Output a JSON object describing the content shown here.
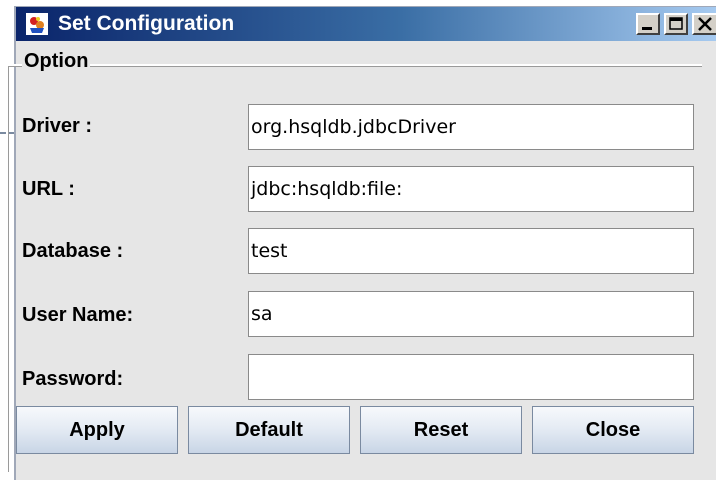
{
  "window": {
    "title": "Set Configuration",
    "icon": "java-cup-icon"
  },
  "title_buttons": {
    "minimize_icon": "minimize-icon",
    "maximize_icon": "maximize-icon",
    "close_icon": "close-icon"
  },
  "option_group": {
    "legend": "Option"
  },
  "fields": {
    "driver": {
      "label": "Driver :",
      "value": "org.hsqldb.jdbcDriver"
    },
    "url": {
      "label": "URL :",
      "value": "jdbc:hsqldb:file:"
    },
    "database": {
      "label": "Database :",
      "value": "test"
    },
    "username": {
      "label": "User Name:",
      "value": "sa"
    },
    "password": {
      "label": "Password:",
      "value": ""
    }
  },
  "buttons": {
    "apply": "Apply",
    "default": "Default",
    "reset": "Reset",
    "close": "Close"
  },
  "colors": {
    "titlebar_start": "#0a246a",
    "titlebar_end": "#a6caf0",
    "panel_bg": "#e6e6e6"
  }
}
